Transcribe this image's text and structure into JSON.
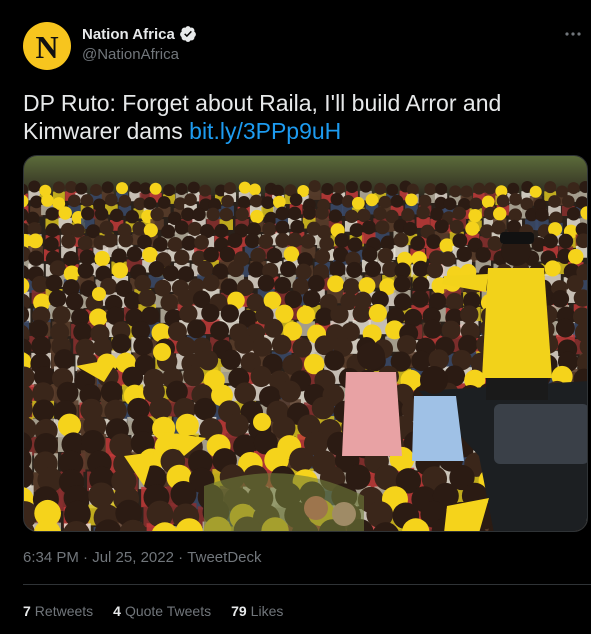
{
  "author": {
    "avatar_letter": "N",
    "display_name": "Nation Africa",
    "handle": "@NationAfrica",
    "verified": true,
    "avatar_color": "#f7c51e"
  },
  "tweet": {
    "text": "DP Ruto: Forget about Raila, I'll build Arror and Kimwarer dams ",
    "link_text": "bit.ly/3PPp9uH",
    "link_color": "#1d9bf0"
  },
  "media": {
    "icon": "photo-crowd-rally-icon"
  },
  "meta": {
    "time": "6:34 PM",
    "separator": "·",
    "date": "Jul 25, 2022",
    "source": "TweetDeck"
  },
  "stats": {
    "retweets_count": "7",
    "retweets_label": "Retweets",
    "quotes_count": "4",
    "quotes_label": "Quote Tweets",
    "likes_count": "79",
    "likes_label": "Likes"
  },
  "icons": {
    "more": "more-horizontal-icon",
    "verified": "verified-badge-icon"
  }
}
